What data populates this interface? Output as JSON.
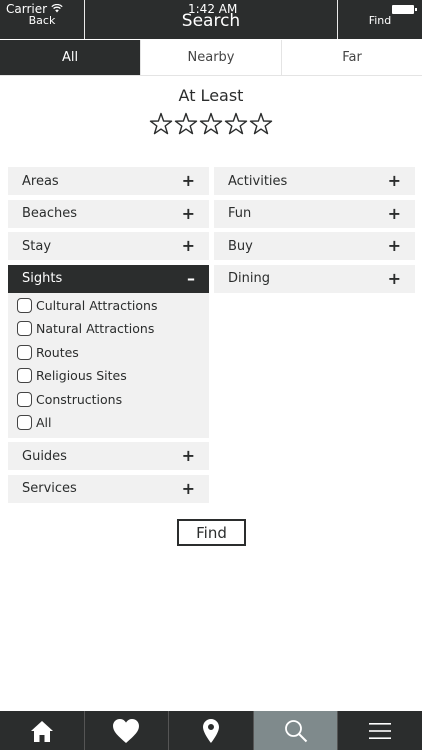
{
  "status_bar": {
    "carrier": "Carrier",
    "time": "1:42 AM"
  },
  "nav": {
    "back_label": "Back",
    "title": "Search",
    "find_label": "Find"
  },
  "segments": [
    {
      "label": "All",
      "active": true
    },
    {
      "label": "Nearby",
      "active": false
    },
    {
      "label": "Far",
      "active": false
    }
  ],
  "rating": {
    "label": "At Least",
    "max_stars": 5,
    "selected": 0
  },
  "categories_left": [
    {
      "label": "Areas",
      "sign": "+"
    },
    {
      "label": "Beaches",
      "sign": "+"
    },
    {
      "label": "Stay",
      "sign": "+"
    },
    {
      "label": "Sights",
      "sign": "–"
    }
  ],
  "sights_options": [
    "Cultural Attractions",
    "Natural Attractions",
    "Routes",
    "Religious Sites",
    "Constructions",
    "All"
  ],
  "categories_left_after": [
    {
      "label": "Guides",
      "sign": "+"
    },
    {
      "label": "Services",
      "sign": "+"
    }
  ],
  "categories_right": [
    {
      "label": "Activities",
      "sign": "+"
    },
    {
      "label": "Fun",
      "sign": "+"
    },
    {
      "label": "Buy",
      "sign": "+"
    },
    {
      "label": "Dining",
      "sign": "+"
    }
  ],
  "find_button": "Find",
  "tabbar": [
    {
      "icon": "home-icon",
      "active": false
    },
    {
      "icon": "heart-icon",
      "active": false
    },
    {
      "icon": "map-pin-icon",
      "active": false
    },
    {
      "icon": "search-icon",
      "active": true
    },
    {
      "icon": "menu-icon",
      "active": false
    }
  ],
  "colors": {
    "dark": "#2b2d2d",
    "panel": "#f1f1f1",
    "active_tab": "#7f8a8c"
  }
}
